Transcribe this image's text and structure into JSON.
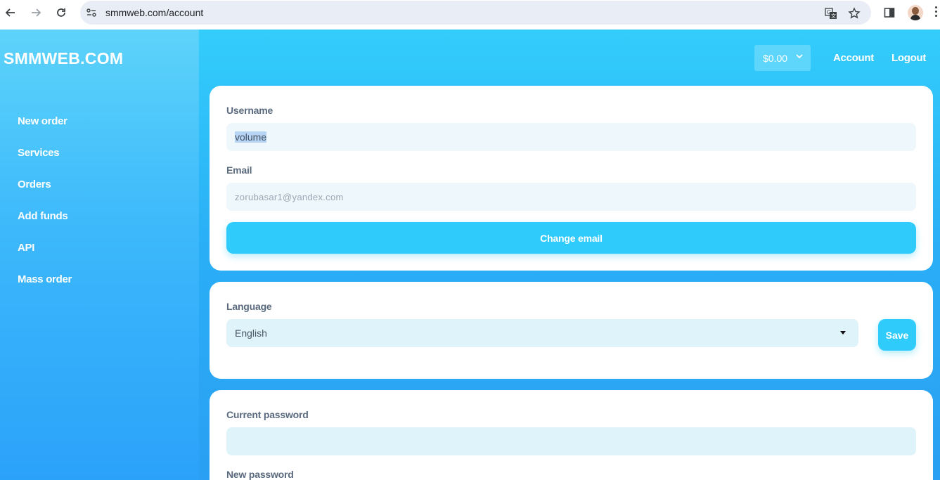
{
  "browser": {
    "url": "smmweb.com/account",
    "icons": [
      "back-arrow-icon",
      "forward-arrow-icon",
      "reload-icon",
      "site-settings-icon",
      "translate-icon",
      "bookmark-star-icon",
      "side-panel-icon",
      "profile-avatar",
      "menu-kebab-icon"
    ]
  },
  "sidebar": {
    "brand": "SMMWEB.COM",
    "items": [
      {
        "label": "New order"
      },
      {
        "label": "Services"
      },
      {
        "label": "Orders"
      },
      {
        "label": "Add funds"
      },
      {
        "label": "API"
      },
      {
        "label": "Mass order"
      }
    ]
  },
  "header": {
    "balance": "$0.00",
    "account_label": "Account",
    "logout_label": "Logout"
  },
  "account_card": {
    "username_label": "Username",
    "username_value": "volume",
    "email_label": "Email",
    "email_placeholder": "zorubasar1@yandex.com",
    "change_email_label": "Change email"
  },
  "language_card": {
    "language_label": "Language",
    "language_value": "English",
    "save_label": "Save"
  },
  "password_card": {
    "current_password_label": "Current password",
    "new_password_label": "New password"
  },
  "colors": {
    "accent": "#2ecbfb",
    "sidebar_top": "#5dd3fa",
    "sidebar_bottom": "#2ba2fa",
    "label": "#5a6a7e"
  }
}
